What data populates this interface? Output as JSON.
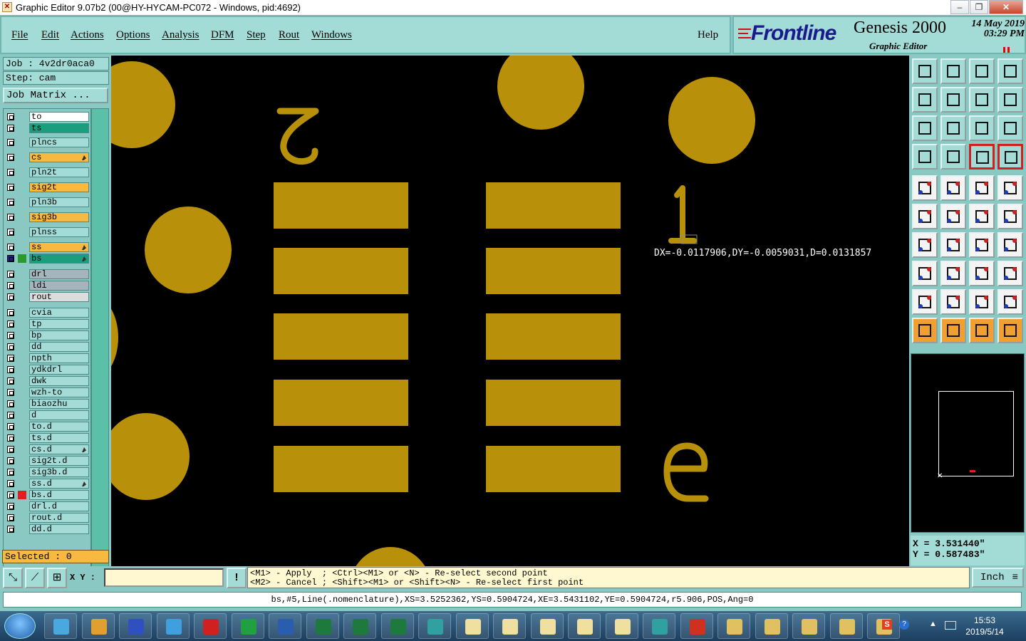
{
  "window": {
    "title": "Graphic Editor 9.07b2 (00@HY-HYCAM-PC072 - Windows, pid:4692)",
    "icon": "app-x-icon",
    "controls": [
      "minimize",
      "maximize",
      "close"
    ]
  },
  "menu": {
    "items": [
      "File",
      "Edit",
      "Actions",
      "Options",
      "Analysis",
      "DFM",
      "Step",
      "Rout",
      "Windows"
    ],
    "help": "Help"
  },
  "brand": {
    "logo": "Frontline",
    "product": "Genesis 2000",
    "subtitle": "Graphic Editor",
    "date": "14 May 2019",
    "time": "03:29 PM"
  },
  "job": {
    "job_label": "Job : 4v2dr0aca0",
    "step_label": "Step: cam",
    "matrix_button": "Job Matrix ..."
  },
  "layers": [
    {
      "name": "to",
      "color": "#ffffff",
      "edit": false
    },
    {
      "name": "ts",
      "color": "#1a9e7e",
      "edit": false
    },
    {
      "name": "plncs",
      "color": "#a3dcd7",
      "edit": false
    },
    {
      "name": "cs",
      "color": "#f8b940",
      "edit": true
    },
    {
      "name": "pln2t",
      "color": "#a3dcd7",
      "edit": false
    },
    {
      "name": "sig2t",
      "color": "#f8b940",
      "edit": false
    },
    {
      "name": "pln3b",
      "color": "#a3dcd7",
      "edit": false
    },
    {
      "name": "sig3b",
      "color": "#f8b940",
      "edit": false
    },
    {
      "name": "plnss",
      "color": "#a3dcd7",
      "edit": false
    },
    {
      "name": "ss",
      "color": "#f8b940",
      "edit": true
    },
    {
      "name": "bs",
      "color": "#1a9e7e",
      "edit": true,
      "swatch": "#2a9a2a",
      "active": true
    },
    {
      "name": "drl",
      "color": "#a8b4bc",
      "edit": false
    },
    {
      "name": "ldi",
      "color": "#a8b4bc",
      "edit": false
    },
    {
      "name": "rout",
      "color": "#dcdcdc",
      "edit": false
    },
    {
      "name": "cvia",
      "color": "#a3dcd7",
      "edit": false
    },
    {
      "name": "tp",
      "color": "#a3dcd7",
      "edit": false
    },
    {
      "name": "bp",
      "color": "#a3dcd7",
      "edit": false
    },
    {
      "name": "dd",
      "color": "#a3dcd7",
      "edit": false
    },
    {
      "name": "npth",
      "color": "#a3dcd7",
      "edit": false
    },
    {
      "name": "ydkdrl",
      "color": "#a3dcd7",
      "edit": false
    },
    {
      "name": "dwk",
      "color": "#a3dcd7",
      "edit": false
    },
    {
      "name": "wzh-to",
      "color": "#a3dcd7",
      "edit": false
    },
    {
      "name": "biaozhu",
      "color": "#a3dcd7",
      "edit": false
    },
    {
      "name": "d",
      "color": "#a3dcd7",
      "edit": false
    },
    {
      "name": "to.d",
      "color": "#a3dcd7",
      "edit": false
    },
    {
      "name": "ts.d",
      "color": "#a3dcd7",
      "edit": false
    },
    {
      "name": "cs.d",
      "color": "#a3dcd7",
      "edit": true
    },
    {
      "name": "sig2t.d",
      "color": "#a3dcd7",
      "edit": false
    },
    {
      "name": "sig3b.d",
      "color": "#a3dcd7",
      "edit": false
    },
    {
      "name": "ss.d",
      "color": "#a3dcd7",
      "edit": true
    },
    {
      "name": "bs.d",
      "color": "#a3dcd7",
      "edit": false,
      "swatch": "#e02020"
    },
    {
      "name": "drl.d",
      "color": "#a3dcd7",
      "edit": false
    },
    {
      "name": "rout.d",
      "color": "#a3dcd7",
      "edit": false
    },
    {
      "name": "dd.d",
      "color": "#a3dcd7",
      "edit": false
    }
  ],
  "selected": "Selected : 0",
  "canvas": {
    "measure": "DX=-0.0117906,DY=-0.0059031,D=0.0131857",
    "pad_color": "#b8900a"
  },
  "coords": {
    "x": "X = 3.531440\"",
    "y": "Y = 0.587483\""
  },
  "bottom": {
    "xy_label": "X Y :",
    "xy_value": "",
    "hint_line1": "<M1> - Apply  ; <Ctrl><M1> or <N> - Re-select second point",
    "hint_line2": "<M2> - Cancel ; <Shift><M1> or <Shift><N> - Re-select first point",
    "unit": "Inch"
  },
  "status": "bs,#5,Line(.nomenclature),XS=3.5252362,YS=0.5904724,XE=3.5431102,YE=0.5904724,r5.906,POS,Ang=0",
  "taskbar": {
    "time": "15:53",
    "date": "2019/5/14"
  }
}
